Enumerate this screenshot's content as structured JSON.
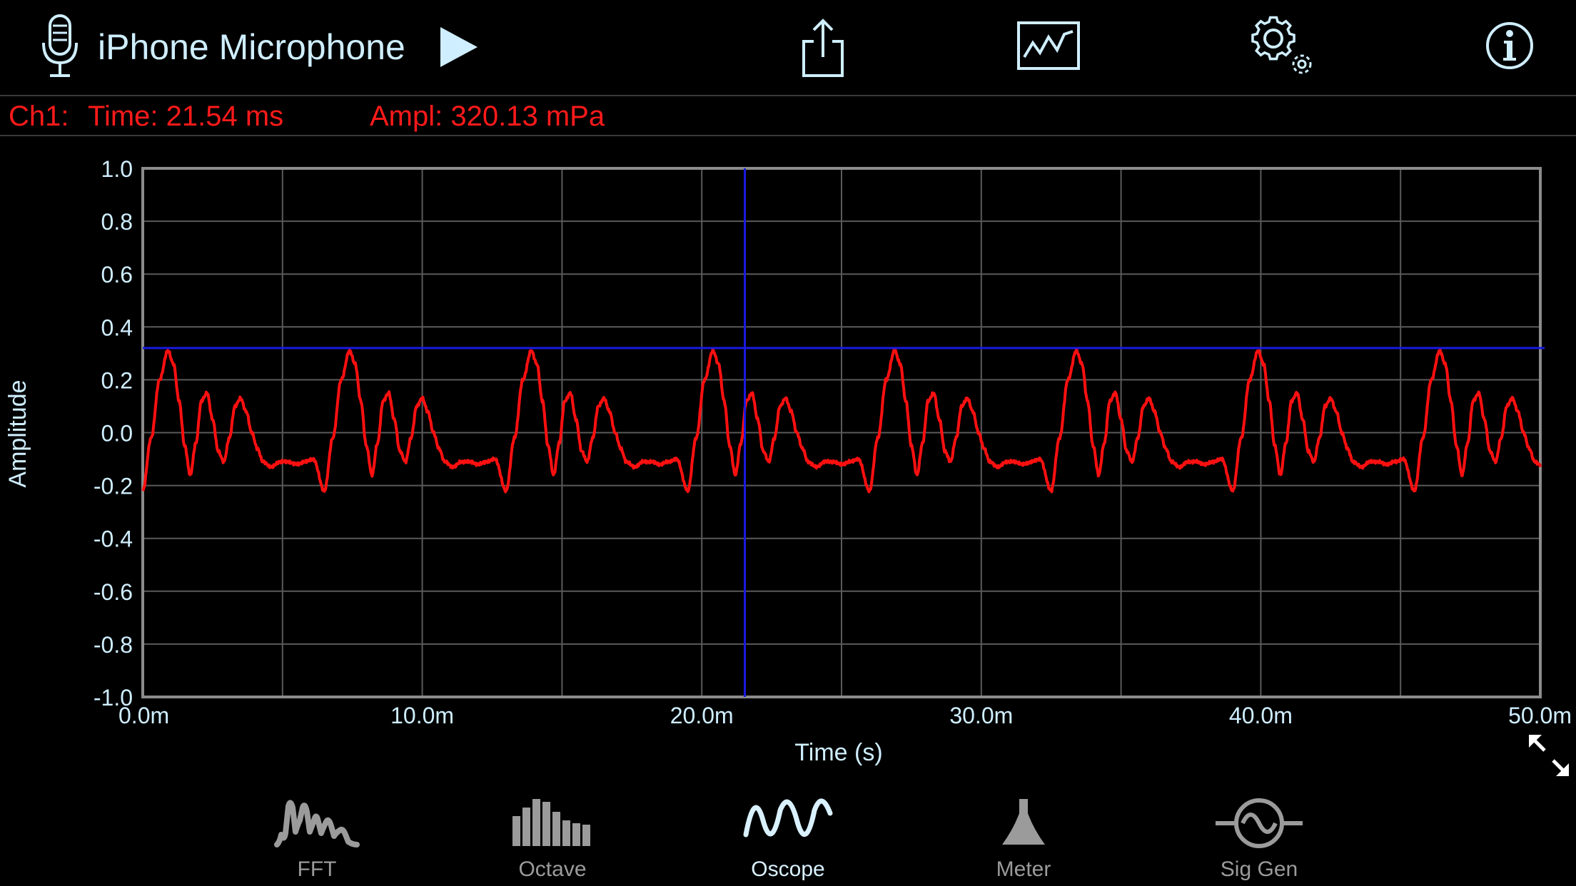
{
  "header": {
    "device_name": "iPhone Microphone",
    "icons": {
      "mic": "microphone-icon",
      "play": "play-icon",
      "share": "share-icon",
      "chart": "chart-view-icon",
      "settings": "settings-gear-icon",
      "info": "info-icon"
    }
  },
  "readout": {
    "channel": "Ch1:",
    "time": "Time: 21.54 ms",
    "amplitude": "Ampl: 320.13 mPa"
  },
  "colors": {
    "trace": "#ff1010",
    "cursor": "#1a1adf",
    "grid": "#5a5a5a",
    "frame": "#8c8c8c",
    "accent": "#cfeeff",
    "readout": "#ff1a1a"
  },
  "chart_data": {
    "type": "line",
    "xlabel": "Time (s)",
    "ylabel": "Amplitude",
    "xlim": [
      0,
      0.05
    ],
    "ylim": [
      -1.0,
      1.0
    ],
    "x_ticks": [
      "0.0m",
      "10.0m",
      "20.0m",
      "30.0m",
      "40.0m",
      "50.0m"
    ],
    "y_ticks": [
      "1.0",
      "0.8",
      "0.6",
      "0.4",
      "0.2",
      "0.0",
      "-0.2",
      "-0.4",
      "-0.6",
      "-0.8",
      "-1.0"
    ],
    "grid": true,
    "cursor": {
      "x": 0.02154,
      "y": 0.32013
    },
    "waveform": {
      "period": 0.0065,
      "template_t": [
        0.0,
        0.0003,
        0.0006,
        0.0009,
        0.0011,
        0.0013,
        0.0015,
        0.0017,
        0.0019,
        0.0021,
        0.0023,
        0.0025,
        0.0027,
        0.0029,
        0.0031,
        0.0033,
        0.0035,
        0.0037,
        0.0039,
        0.0041,
        0.0043,
        0.0046,
        0.0049,
        0.0052,
        0.0055,
        0.0058,
        0.0061,
        0.0065
      ],
      "template_v": [
        -0.22,
        -0.02,
        0.2,
        0.31,
        0.26,
        0.12,
        -0.05,
        -0.16,
        -0.04,
        0.12,
        0.15,
        0.05,
        -0.07,
        -0.11,
        -0.02,
        0.1,
        0.13,
        0.08,
        0.0,
        -0.06,
        -0.11,
        -0.13,
        -0.11,
        -0.11,
        -0.12,
        -0.11,
        -0.1,
        -0.22
      ],
      "start_t": 0.0
    }
  },
  "tabs": [
    {
      "label": "FFT",
      "icon": "fft-icon",
      "active": false
    },
    {
      "label": "Octave",
      "icon": "octave-bars-icon",
      "active": false
    },
    {
      "label": "Oscope",
      "icon": "oscope-wave-icon",
      "active": true
    },
    {
      "label": "Meter",
      "icon": "meter-icon",
      "active": false
    },
    {
      "label": "Sig Gen",
      "icon": "signal-generator-icon",
      "active": false
    }
  ],
  "expand_icon": "expand-icon"
}
